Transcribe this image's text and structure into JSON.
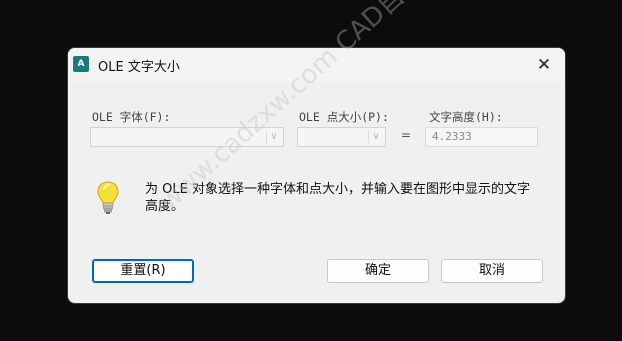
{
  "dialog": {
    "title": "OLE 文字大小",
    "app_icon_text": "A",
    "close_glyph": "✕"
  },
  "fields": {
    "font_label": "OLE 字体(F):",
    "font_value": "",
    "point_size_label": "OLE 点大小(P):",
    "point_size_value": "",
    "equals": "=",
    "text_height_label": "文字高度(H):",
    "text_height_value": "4.2333",
    "dropdown_glyph": "∨"
  },
  "message": {
    "text": "为 OLE 对象选择一种字体和点大小，并输入要在图形中显示的文字高度。",
    "icon": "lightbulb-icon"
  },
  "buttons": {
    "reset": "重置(R)",
    "ok": "确定",
    "cancel": "取消"
  },
  "watermark": {
    "text": "www.cadzxw.com  CAD自学网"
  },
  "colors": {
    "accent": "#0067c0",
    "dialog_bg": "#f0f0f0",
    "backdrop": "#0c0c0c"
  }
}
